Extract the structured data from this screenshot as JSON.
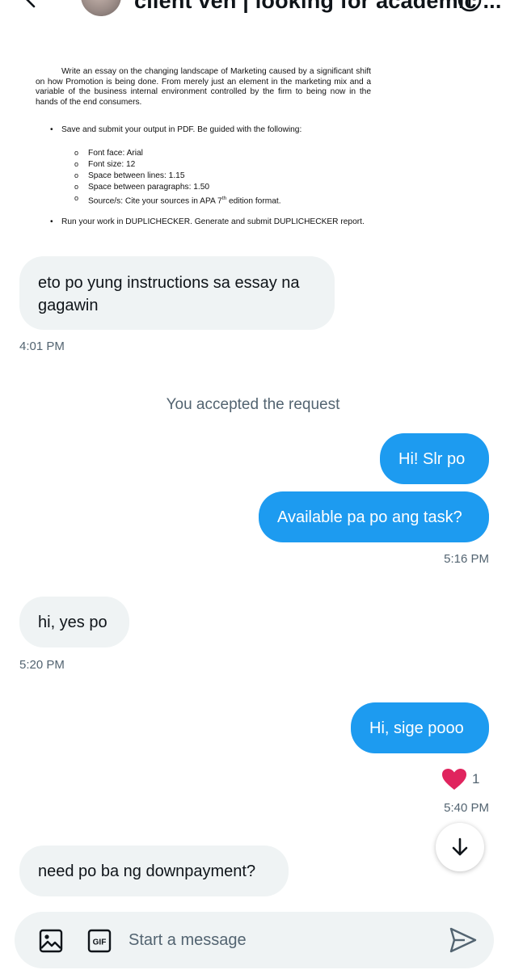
{
  "header": {
    "title": "client ven | looking for academic ...",
    "back_icon": "arrow-left-icon",
    "info_icon": "info-icon"
  },
  "attachment": {
    "paragraph": "Write an essay on the changing landscape of Marketing caused by a significant shift on how Promotion is being done. From merely just an element in the marketing mix and a variable of the business internal environment controlled by the firm to being now in the hands of the end consumers.",
    "bullet_1": "Save and submit your output in PDF. Be guided with the following:",
    "sub_items": [
      "Font face: Arial",
      "Font size: 12",
      "Space between lines: 1.15",
      "Space between paragraphs: 1.50"
    ],
    "sub_item_5_pre": "Source/s: Cite your sources in APA 7",
    "sub_item_5_sup": "th",
    "sub_item_5_post": " edition format.",
    "bullet_2": "Run your work in DUPLICHECKER. Generate and submit DUPLICHECKER report."
  },
  "messages": [
    {
      "direction": "in",
      "lines": [
        "eto po yung instructions sa essay na",
        "gagawin"
      ],
      "time": "4:01 PM"
    },
    {
      "direction": "out",
      "lines": [
        "Hi! Slr po"
      ]
    },
    {
      "direction": "out",
      "lines": [
        "Available pa po ang task?"
      ],
      "time": "5:16 PM"
    },
    {
      "direction": "in",
      "lines": [
        "hi, yes po"
      ],
      "time": "5:20 PM"
    },
    {
      "direction": "out",
      "lines": [
        "Hi, sige pooo"
      ],
      "time": "5:40 PM"
    },
    {
      "direction": "in",
      "lines": [
        "need po ba ng downpayment?"
      ]
    }
  ],
  "system_message": "You accepted the request",
  "reaction": {
    "emoji": "heart-icon",
    "count": "1",
    "color": "#e0245e"
  },
  "composer": {
    "placeholder": "Start a message",
    "image_icon": "image-icon",
    "gif_icon": "gif-icon",
    "gif_label": "GIF",
    "send_icon": "send-icon"
  },
  "colors": {
    "accent": "#1d9bf0",
    "incoming_bubble": "#eff3f4",
    "muted_text": "#536471"
  }
}
